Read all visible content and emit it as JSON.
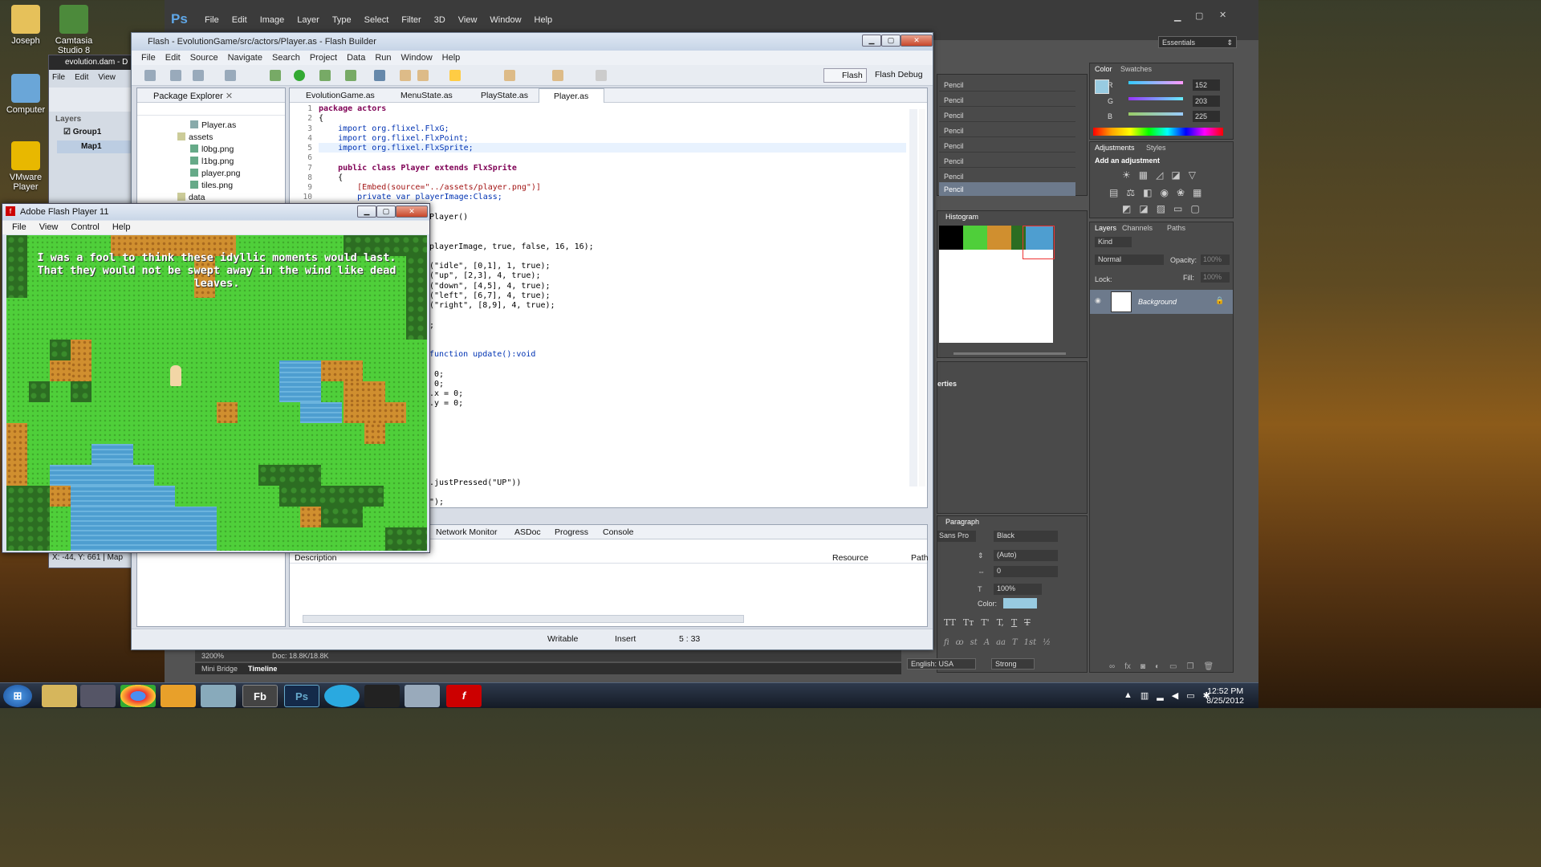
{
  "desktop": {
    "icons": [
      {
        "label": "Joseph"
      },
      {
        "label": "Camtasia Studio 8"
      },
      {
        "label": "Computer"
      },
      {
        "label": "VMware Player"
      }
    ]
  },
  "photoshop": {
    "logo": "Ps",
    "menu": [
      "File",
      "Edit",
      "Image",
      "Layer",
      "Type",
      "Select",
      "Filter",
      "3D",
      "View",
      "Window",
      "Help"
    ],
    "workspace": "Essentials",
    "history_items": [
      "Pencil",
      "Pencil",
      "Pencil",
      "Pencil",
      "Pencil",
      "Pencil",
      "Pencil",
      "Pencil"
    ],
    "color_tabs": [
      "Color",
      "Swatches"
    ],
    "rgb": {
      "r_label": "R",
      "r": "152",
      "g_label": "G",
      "g": "203",
      "b_label": "B",
      "b": "225"
    },
    "adjustment_tabs": [
      "Adjustments",
      "Styles"
    ],
    "add_adjustment": "Add an adjustment",
    "histogram_tab": "Histogram",
    "layers_tabs": [
      "Layers",
      "Channels",
      "Paths"
    ],
    "kind": "Kind",
    "blend": "Normal",
    "opacity_label": "Opacity:",
    "opacity": "100%",
    "lock_label": "Lock:",
    "fill_label": "Fill:",
    "fill": "100%",
    "layer_name": "Background",
    "properties_partial": "erties",
    "paragraph_tab": "Paragraph",
    "font_family_partial": "Sans Pro",
    "font_color": "Black",
    "leading": "(Auto)",
    "tracking": "0",
    "scale": "100%",
    "color_label": "Color:",
    "language": "English: USA",
    "antialias": "Strong",
    "zoom": "3200%",
    "doc": "Doc: 18.8K/18.8K",
    "bottom_tabs": [
      "Mini Bridge",
      "Timeline"
    ],
    "type_glyphs": [
      "TT",
      "Tт",
      "T'",
      "T,",
      "T",
      "T"
    ],
    "otype_glyphs": [
      "fi",
      "ꝏ",
      "st",
      "A",
      "aa",
      "T",
      "1st",
      "½"
    ],
    "swatch_color": "#98cbe1"
  },
  "tiled": {
    "title": "evolution.dam - D",
    "menu": [
      "File",
      "Edit",
      "View"
    ],
    "layers_label": "Layers",
    "group": "Group1",
    "map": "Map1",
    "coords": "X: -44, Y: 661 | Map"
  },
  "flashbuilder": {
    "title": "Flash - EvolutionGame/src/actors/Player.as - Flash Builder",
    "menu": [
      "File",
      "Edit",
      "Source",
      "Navigate",
      "Search",
      "Project",
      "Data",
      "Run",
      "Window",
      "Help"
    ],
    "perspectives": [
      "Flash",
      "Flash Debug"
    ],
    "package_explorer": "Package Explorer",
    "tree": [
      "Player.as",
      "assets",
      "l0bg.png",
      "l1bg.png",
      "player.png",
      "tiles.png",
      "data"
    ],
    "tabs": [
      "EvolutionGame.as",
      "MenuState.as",
      "PlayState.as",
      "Player.as"
    ],
    "line_numbers": [
      "1",
      "2",
      "3",
      "4",
      "5",
      "6",
      "7",
      "8",
      "9",
      "10"
    ],
    "code": [
      "package actors",
      "{",
      "    import org.flixel.FlxG;",
      "    import org.flixel.FlxPoint;",
      "    import org.flixel.FlxSprite;",
      "",
      "    public class Player extends FlxSprite",
      "    {",
      "        [Embed(source=\"../assets/player.png\")]",
      "        private var playerImage:Class;",
      "Player()",
      "",
      "",
      "playerImage, true, false, 16, 16);",
      "",
      "(\"idle\", [0,1], 1, true);",
      "(\"up\", [2,3], 4, true);",
      "(\"down\", [4,5], 4, true);",
      "(\"left\", [6,7], 4, true);",
      "(\"right\", [8,9], 4, true);",
      ";",
      "",
      "",
      "function update():void",
      "",
      " 0;",
      " 0;",
      ".x = 0;",
      ".y = 0;",
      ".justPressed(\"UP\"))",
      "\");"
    ],
    "bottom_tabs": [
      "Network Monitor",
      "ASDoc",
      "Progress",
      "Console"
    ],
    "columns": [
      "Description",
      "Resource",
      "Path"
    ],
    "status": {
      "writable": "Writable",
      "insert": "Insert",
      "position": "5 : 33"
    }
  },
  "flashplayer": {
    "title": "Adobe Flash Player 11",
    "menu": [
      "File",
      "View",
      "Control",
      "Help"
    ],
    "story": [
      "I was a fool to think these idyllic moments would last.",
      "That they would not be swept away in the wind like dead",
      "leaves."
    ]
  },
  "taskbar": {
    "apps": [
      "Fb",
      "Ps"
    ],
    "time": "12:52 PM",
    "date": "8/25/2012"
  }
}
